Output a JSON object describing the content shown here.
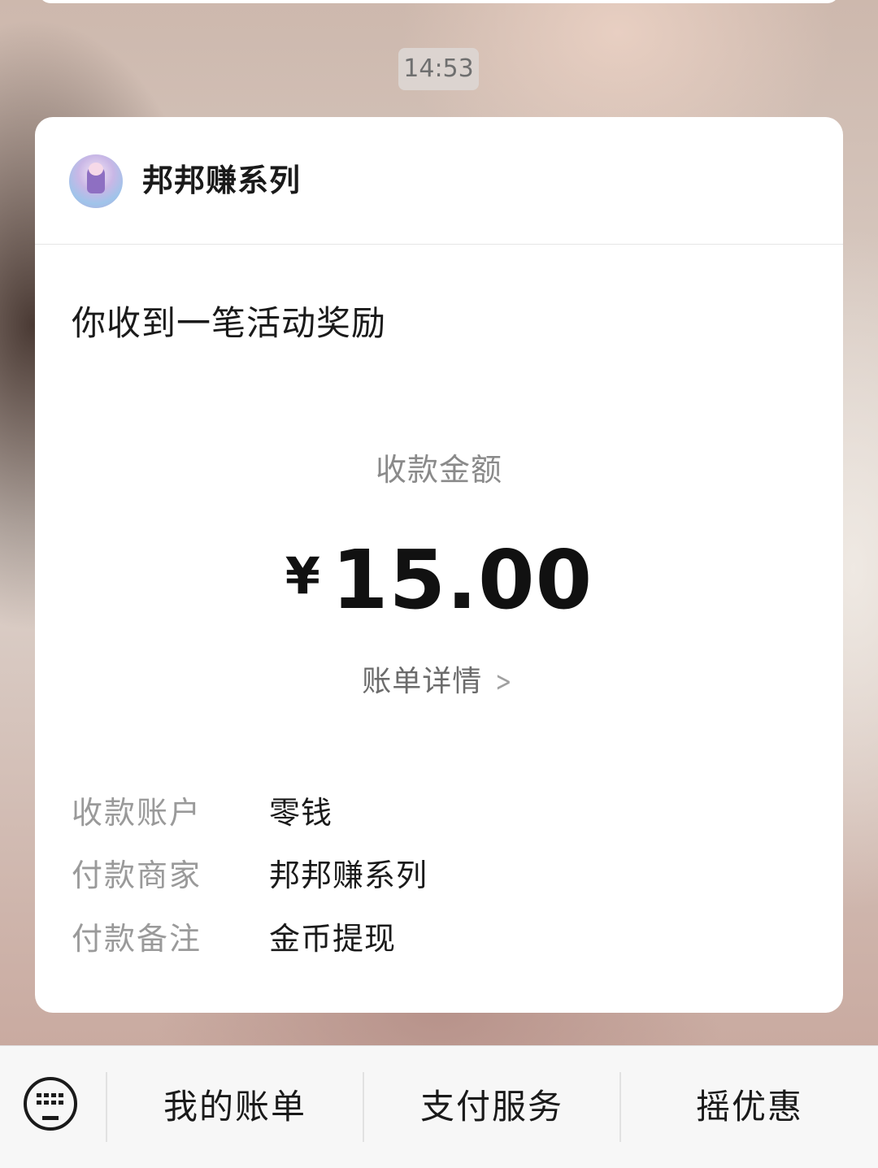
{
  "chat": {
    "timestamp": "14:53"
  },
  "card": {
    "merchant_name": "邦邦赚系列",
    "notice": "你收到一笔活动奖励",
    "amount_label": "收款金额",
    "currency": "¥",
    "amount": "15.00",
    "bill_detail": "账单详情",
    "info": [
      {
        "key": "收款账户",
        "value": "零钱"
      },
      {
        "key": "付款商家",
        "value": "邦邦赚系列"
      },
      {
        "key": "付款备注",
        "value": "金币提现"
      }
    ]
  },
  "bottom_menu": {
    "items": [
      "我的账单",
      "支付服务",
      "摇优惠"
    ]
  },
  "icons": {
    "keyboard": "keyboard-icon",
    "chevron": "chevron-right-icon"
  }
}
